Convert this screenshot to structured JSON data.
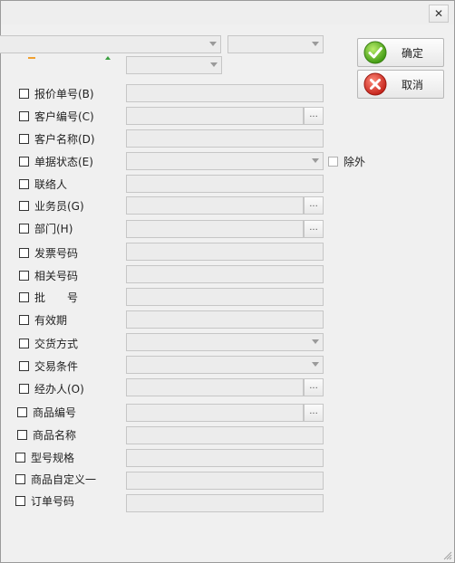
{
  "window": {
    "close_glyph": "✕"
  },
  "buttons": {
    "ok": "确定",
    "cancel": "取消"
  },
  "exclude": {
    "label": "除外"
  },
  "fields": [
    {
      "label": "报价单号(B)"
    },
    {
      "label": "客户编号(C)"
    },
    {
      "label": "客户名称(D)"
    },
    {
      "label": "单据状态(E)"
    },
    {
      "label": "联络人"
    },
    {
      "label": "业务员(G)"
    },
    {
      "label": "部门(H)"
    },
    {
      "label": "发票号码"
    },
    {
      "label": "相关号码"
    },
    {
      "label": "批　　号"
    },
    {
      "label": "有效期"
    },
    {
      "label": "交货方式"
    },
    {
      "label": "交易条件"
    },
    {
      "label": "经办人(O)"
    },
    {
      "label": "商品编号"
    },
    {
      "label": "商品名称"
    },
    {
      "label": "型号规格"
    },
    {
      "label": "商品自定义一"
    },
    {
      "label": "订单号码"
    }
  ],
  "dots_label": "..."
}
